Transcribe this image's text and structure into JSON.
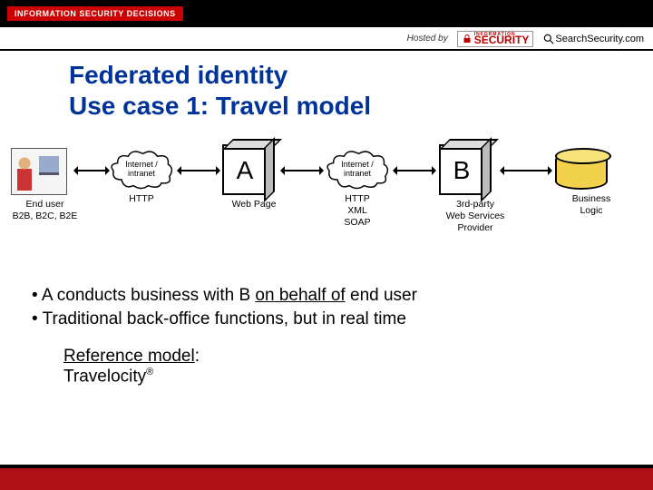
{
  "header": {
    "isd_logo": "INFORMATION SECURITY DECISIONS",
    "hosted_by": "Hosted by",
    "security_logo": "SECURITY",
    "security_logo_small": "INFORMATION",
    "search_security": "SearchSecurity.com"
  },
  "title_line1": "Federated identity",
  "title_line2": "Use case 1: Travel model",
  "diagram": {
    "enduser": {
      "caption": "End user\nB2B, B2C, B2E"
    },
    "cloud1": {
      "label": "Internet /\nintranet",
      "caption": "HTTP"
    },
    "serverA": {
      "letter": "A",
      "caption": "Web Page"
    },
    "cloud2": {
      "label": "Internet /\nintranet",
      "caption": "HTTP\nXML\nSOAP"
    },
    "serverB": {
      "letter": "B",
      "caption": "3rd-party\nWeb Services\nProvider"
    },
    "cylinder": {
      "caption": "Business\nLogic"
    }
  },
  "bullets": {
    "b1_pre": "A conducts business with B ",
    "b1_underlined": "on behalf of",
    "b1_post": " end user",
    "b2": "Traditional back-office functions, but in real time"
  },
  "refmodel": {
    "label": "Reference model",
    "value": "Travelocity",
    "sup": "®"
  }
}
